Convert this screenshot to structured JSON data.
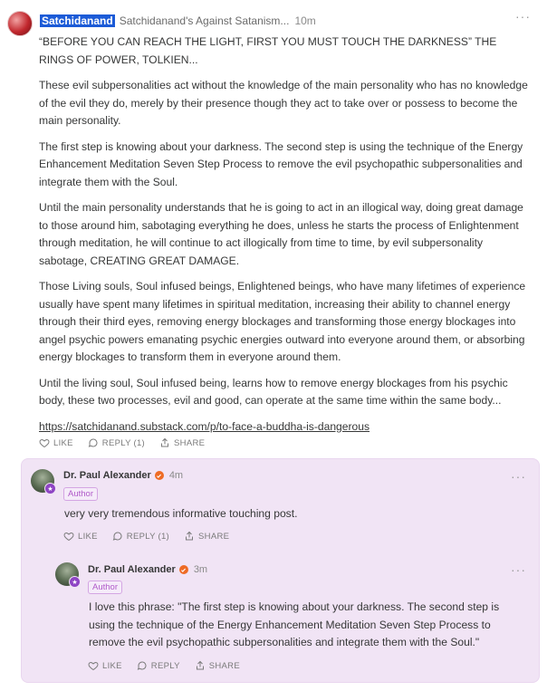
{
  "post": {
    "author": "Satchidanand",
    "publication": "Satchidanand's Against Satanism...",
    "time": "10m",
    "more": "···",
    "paragraphs": [
      "“BEFORE YOU CAN REACH THE LIGHT, FIRST YOU MUST TOUCH THE DARKNESS” THE RINGS OF POWER, TOLKIEN...",
      "These evil subpersonalities act without the knowledge of the main personality who has no knowledge of the evil they do, merely by their presence though they act to take over or possess to become the main personality.",
      "The first step is knowing about your darkness. The second step is using the technique of the Energy Enhancement Meditation Seven Step Process to remove the evil psychopathic subpersonalities and integrate them with the Soul.",
      "Until the main personality understands that he is going to act in an illogical way, doing great damage to those around him, sabotaging everything he does, unless he starts the process of Enlightenment through meditation, he will continue to act illogically from time to time, by evil subpersonality sabotage, CREATING GREAT DAMAGE.",
      "Those Living souls, Soul infused beings, Enlightened beings, who have many lifetimes of experience usually have spent many lifetimes in spiritual meditation, increasing their ability to channel energy through their third eyes, removing energy blockages and transforming those energy blockages into angel psychic powers emanating psychic energies outward into everyone around them, or absorbing energy blockages to transform them in everyone around them.",
      "Until the living soul, Soul infused being, learns how to remove energy blockages from his psychic body, these two processes, evil and good, can operate at the same time within the same body..."
    ],
    "link": "https://satchidanand.substack.com/p/to-face-a-buddha-is-dangerous",
    "actions": {
      "like": "LIKE",
      "reply": "REPLY (1)",
      "share": "SHARE"
    }
  },
  "reply1": {
    "author": "Dr. Paul Alexander",
    "time": "4m",
    "tag": "Author",
    "text": "very very tremendous informative touching post.",
    "more": "···",
    "actions": {
      "like": "LIKE",
      "reply": "REPLY (1)",
      "share": "SHARE"
    }
  },
  "reply2": {
    "author": "Dr. Paul Alexander",
    "time": "3m",
    "tag": "Author",
    "text": "I love this phrase: \"The first step is knowing about your darkness. The second step is using the technique of the Energy Enhancement Meditation Seven Step Process to remove the evil psychopathic subpersonalities and integrate them with the Soul.\"",
    "more": "···",
    "actions": {
      "like": "LIKE",
      "reply": "REPLY",
      "share": "SHARE"
    }
  },
  "colors": {
    "highlight": "#1c5bd7",
    "thread_bg": "#f1e4f5",
    "author_tag": "#b05ac9",
    "verified": "#ee6b25"
  },
  "icons": [
    "heart-icon",
    "reply-bubble-icon",
    "share-icon",
    "verified-icon",
    "subscriber-badge-icon",
    "more-icon"
  ]
}
